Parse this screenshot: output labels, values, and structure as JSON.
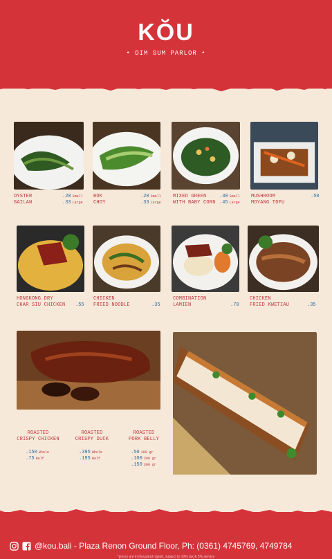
{
  "header": {
    "logo": "KŎU",
    "tagline": "• DIM SUM PARLOR •"
  },
  "menu": {
    "row1": [
      {
        "name1": "OYSTER",
        "name2": "GAILAN",
        "p1": ".20",
        "s1": "Small",
        "p2": ".33",
        "s2": "Large"
      },
      {
        "name1": "BOK",
        "name2": "CHOY",
        "p1": ".20",
        "s1": "Small",
        "p2": ".33",
        "s2": "Large"
      },
      {
        "name1": "MIXED GREEN",
        "name2": "WITH BABY CORN",
        "p1": ".30",
        "s1": "Small",
        "p2": ".45",
        "s2": "Large"
      },
      {
        "name1": "MUSHROOM",
        "name2": "MOYANG TOFU",
        "p1": ".50"
      }
    ],
    "row2": [
      {
        "name1": "HONGKONG DRY",
        "name2": "CHAR SIU CHICKEN",
        "p1": ".55"
      },
      {
        "name1": "CHICKEN",
        "name2": "FRIED NOODLE",
        "p1": ".35"
      },
      {
        "name1": "COMBINATION",
        "name2": "LAMIEN",
        "p1": ".70"
      },
      {
        "name1": "CHICKEN",
        "name2": "FRIED KWETIAU",
        "p1": ".35"
      }
    ],
    "roasted": [
      {
        "name1": "ROASTED",
        "name2": "CRISPY CHICKEN",
        "p1": ".150",
        "s1": "Whole",
        "p2": ".75",
        "s2": "Half"
      },
      {
        "name1": "ROASTED",
        "name2": "CRISPY DUCK",
        "p1": ".395",
        "s1": "Whole",
        "p2": ".195",
        "s2": "Half"
      },
      {
        "name1": "ROASTED",
        "name2": "PORK BELLY",
        "p1": ".50",
        "s1": "100 gr",
        "p2": ".100",
        "s2": "200 gr",
        "p3": ".150",
        "s3": "300 gr"
      }
    ]
  },
  "footer": {
    "contact": "@kou.bali - Plaza Renon Ground Floor, Ph: (0361) 4745769, 4749784",
    "note": "*prices are in thousand rupiah, subject to 10% tax & 5% service",
    "icons": [
      "instagram-icon",
      "facebook-icon"
    ]
  },
  "colors": {
    "brand_red": "#d5333a",
    "paper": "#f6e9da",
    "price_blue": "#2c6b9e"
  }
}
